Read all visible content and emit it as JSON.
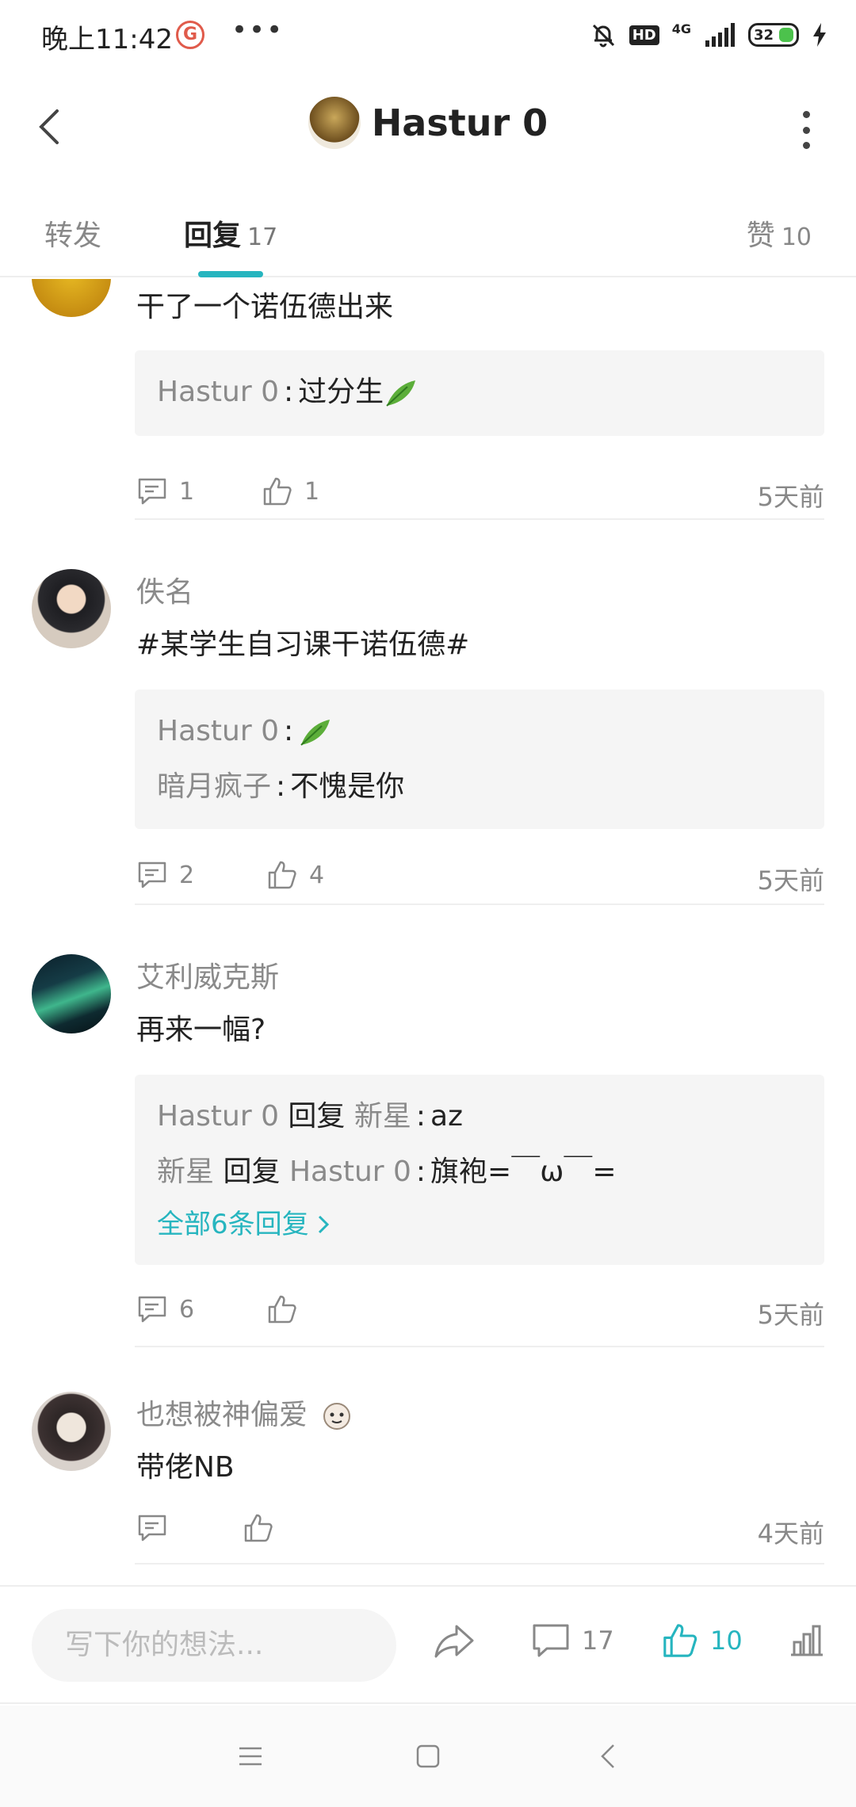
{
  "status_bar": {
    "time": "晚上11:42",
    "dots": "•••",
    "hd": "HD",
    "network": "4G",
    "battery": "32"
  },
  "header": {
    "title": "Hastur 0"
  },
  "tabs": [
    {
      "label": "转发",
      "count": ""
    },
    {
      "label": "回复",
      "count": "17"
    },
    {
      "label": "赞",
      "count": "10"
    }
  ],
  "comments": [
    {
      "author": "",
      "text": "干了一个诺伍德出来",
      "replies": [
        {
          "user": "Hastur 0",
          "sep": ":",
          "text": "过分生",
          "leaf": true
        }
      ],
      "reply_count": "1",
      "like_count": "1",
      "time": "5天前"
    },
    {
      "author": "佚名",
      "text": "#某学生自习课干诺伍德#",
      "replies": [
        {
          "user": "Hastur 0",
          "sep": ":",
          "text": "",
          "leaf": true
        },
        {
          "user": "暗月疯子",
          "sep": ":",
          "text": "不愧是你"
        }
      ],
      "reply_count": "2",
      "like_count": "4",
      "time": "5天前"
    },
    {
      "author": "艾利威克斯",
      "text": "再来一幅?",
      "replies": [
        {
          "user": "Hastur 0",
          "mid": "回复",
          "user2": "新星",
          "sep": ":",
          "text": "az"
        },
        {
          "user": "新星",
          "mid": "回复",
          "user2": "Hastur 0",
          "sep": ":",
          "text": "旗袍=￣ω￣="
        }
      ],
      "more_replies": "全部6条回复",
      "reply_count": "6",
      "like_count": "",
      "time": "5天前"
    },
    {
      "author": "也想被神偏爱",
      "text": "带佬NB",
      "reply_count": "",
      "like_count": "",
      "time": "4天前"
    }
  ],
  "bottom_bar": {
    "input_placeholder": "写下你的想法...",
    "comment_count": "17",
    "like_count": "10"
  },
  "colors": {
    "accent": "#26b5bf",
    "muted": "#8a8a8a"
  }
}
